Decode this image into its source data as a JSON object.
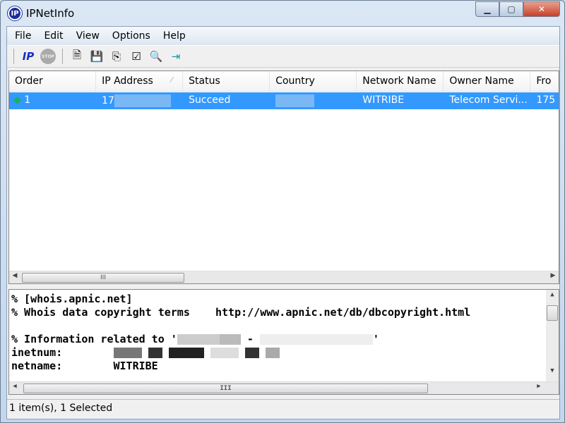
{
  "window": {
    "title": "IPNetInfo",
    "logo": "IP"
  },
  "menu": [
    "File",
    "Edit",
    "View",
    "Options",
    "Help"
  ],
  "toolbar": [
    {
      "icon": "ip-icon",
      "label": "IP"
    },
    {
      "icon": "stop-icon",
      "label": "STOP"
    },
    {
      "icon": "report-icon"
    },
    {
      "icon": "save-icon"
    },
    {
      "icon": "copy-icon"
    },
    {
      "icon": "properties-icon"
    },
    {
      "icon": "find-icon"
    },
    {
      "icon": "exit-icon"
    }
  ],
  "list": {
    "columns": [
      "Order",
      "IP Address",
      "Status",
      "Country",
      "Network Name",
      "Owner Name",
      "Fro"
    ],
    "rows": [
      {
        "order": "1",
        "ip": "17",
        "status": "Succeed",
        "country": "",
        "network": "WITRIBE",
        "owner": "Telecom Servi...",
        "from": "175"
      }
    ]
  },
  "whois": {
    "lines": [
      "% [whois.apnic.net]",
      "% Whois data copyright terms    http://www.apnic.net/db/dbcopyright.html",
      "",
      "% Information related to '",
      "inetnum:",
      "netname:        WITRIBE"
    ],
    "sep": " - ",
    "quote": "'"
  },
  "status": {
    "text": "1 item(s), 1 Selected"
  },
  "colors": {
    "selection": "#3399ff",
    "close": "#c7402a"
  }
}
